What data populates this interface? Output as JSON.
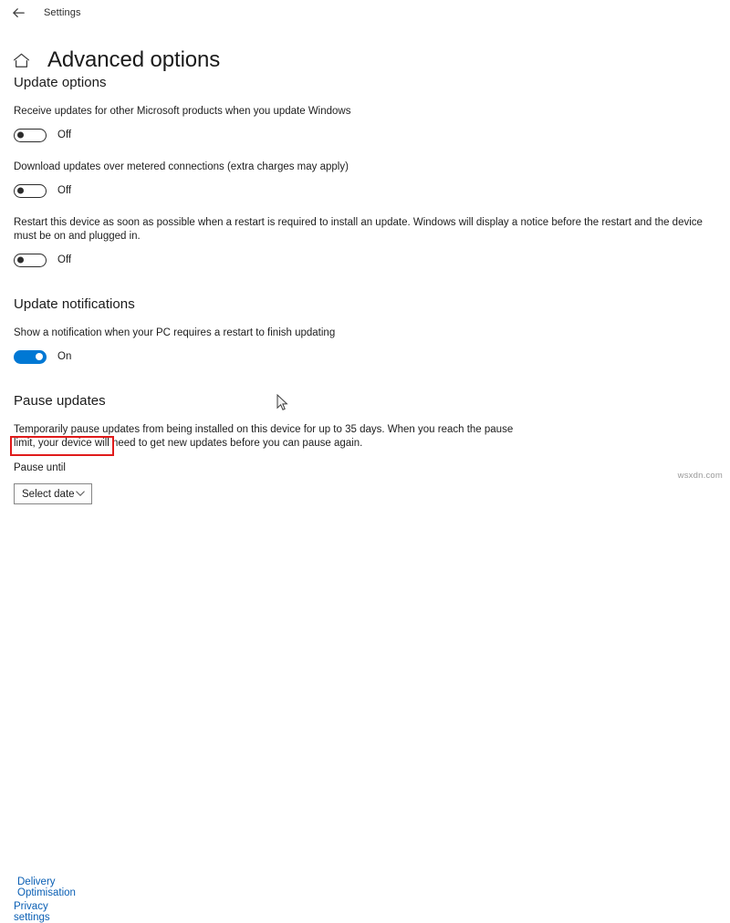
{
  "breadcrumb": {
    "back_icon": "back-arrow-icon",
    "label": "Settings"
  },
  "header": {
    "home_icon": "home-icon",
    "title": "Advanced options"
  },
  "sections": {
    "update_options": {
      "heading": "Update options",
      "items": [
        {
          "description": "Receive updates for other Microsoft products when you update Windows",
          "state_label": "Off",
          "state": "off"
        },
        {
          "description": "Download updates over metered connections (extra charges may apply)",
          "state_label": "Off",
          "state": "off"
        },
        {
          "description": "Restart this device as soon as possible when a restart is required to install an update. Windows will display a notice before the restart and the device must be on and plugged in.",
          "state_label": "Off",
          "state": "off"
        }
      ]
    },
    "update_notifications": {
      "heading": "Update notifications",
      "items": [
        {
          "description": "Show a notification when your PC requires a restart to finish updating",
          "state_label": "On",
          "state": "on"
        }
      ]
    },
    "pause_updates": {
      "heading": "Pause updates",
      "description": "Temporarily pause updates from being installed on this device for up to 35 days. When you reach the pause limit, your device will need to get new updates before you can pause again.",
      "field_label": "Pause until",
      "select_value": "Select date",
      "chevron_icon": "chevron-down-icon"
    }
  },
  "links": [
    {
      "label": "Delivery Optimisation",
      "highlighted": true
    },
    {
      "label": "Privacy settings",
      "highlighted": false
    }
  ],
  "watermark": "wsxdn.com",
  "colors": {
    "accent": "#0078d4",
    "link": "#0a5fb4",
    "highlight": "#e01b1b",
    "text": "#1d1d1d"
  }
}
